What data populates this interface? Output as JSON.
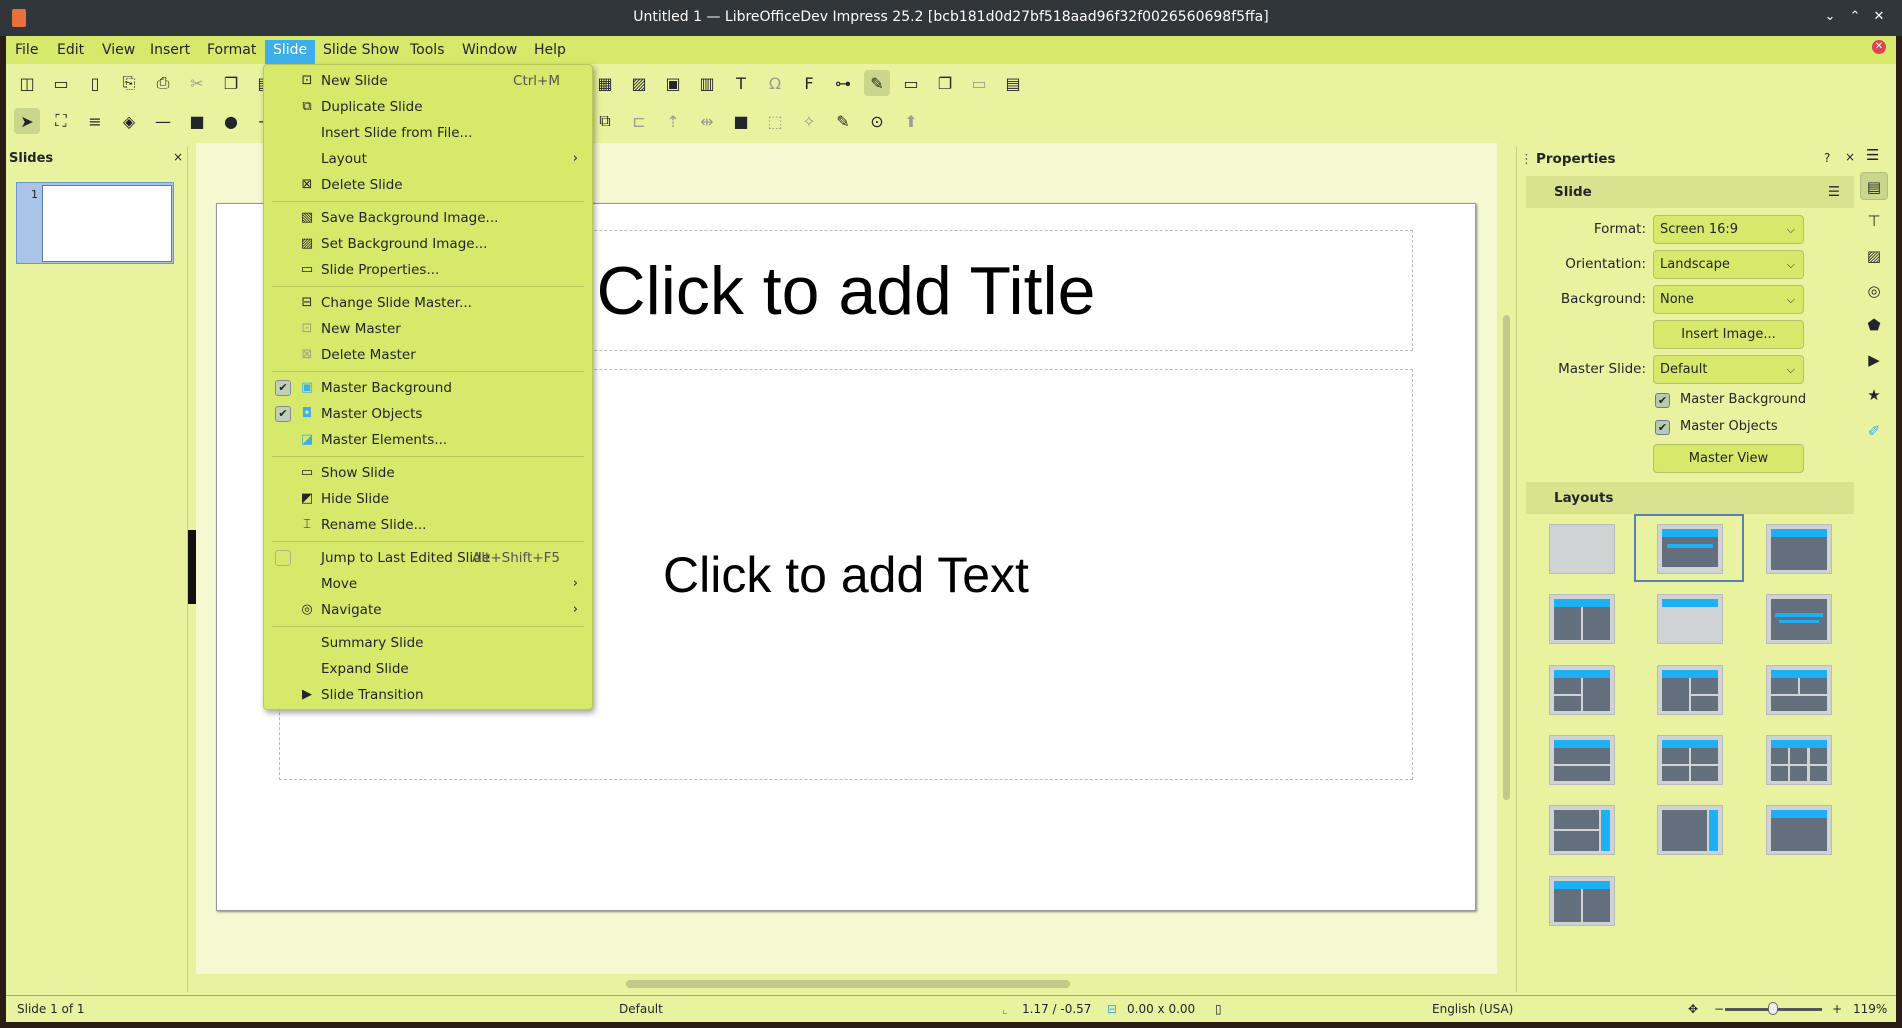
{
  "window": {
    "title": "Untitled 1 — LibreOfficeDev Impress 25.2 [bcb181d0d27bf518aad96f32f0026560698f5ffa]",
    "minimize": "⌄",
    "maximize": "⌃",
    "close": "✕"
  },
  "colors": {
    "menubar": "#d6e96b",
    "panel": "#e9f29e",
    "accent": "#3daee9",
    "layout_title_bar": "#1eb0f5"
  },
  "menubar": {
    "items": [
      "File",
      "Edit",
      "View",
      "Insert",
      "Format",
      "Slide",
      "Slide Show",
      "Tools",
      "Window",
      "Help"
    ],
    "active": "Slide"
  },
  "toolbar1": [
    {
      "n": "templates-icon",
      "g": "◫"
    },
    {
      "n": "open-icon",
      "g": "▭"
    },
    {
      "n": "save-icon",
      "g": "▯"
    },
    {
      "n": "export-pdf-icon",
      "g": "⎘"
    },
    {
      "n": "print-icon",
      "g": "⎙"
    },
    {
      "n": "cut-icon",
      "g": "✂",
      "dim": true
    },
    {
      "n": "copy-icon",
      "g": "❐"
    },
    {
      "n": "paste-icon",
      "g": "▤"
    },
    {
      "n": "clone-icon",
      "g": "✎"
    },
    {
      "n": "undo-icon",
      "g": "↶"
    },
    {
      "n": "redo-icon",
      "g": "↷"
    },
    {
      "n": "spelling-icon",
      "g": "✓"
    },
    {
      "n": "grid-icon",
      "g": "⋮",
      "on": true
    },
    {
      "n": "slide-layout-icon",
      "g": "▦"
    },
    {
      "n": "comment-icon",
      "g": "✐"
    },
    {
      "n": "start-first-slide-icon",
      "g": "▶"
    },
    {
      "n": "start-current-slide-icon",
      "g": "⏸"
    },
    {
      "n": "table-icon",
      "g": "▦"
    },
    {
      "n": "image-icon",
      "g": "▨"
    },
    {
      "n": "media-icon",
      "g": "▣"
    },
    {
      "n": "chart-icon",
      "g": "▥"
    },
    {
      "n": "textbox-icon",
      "g": "T"
    },
    {
      "n": "special-char-icon",
      "g": "Ω",
      "dim": true
    },
    {
      "n": "fontwork-icon",
      "g": "F"
    },
    {
      "n": "hyperlink-icon",
      "g": "⊶"
    },
    {
      "n": "draw-icon",
      "g": "✎",
      "on": true
    },
    {
      "n": "new-slide-icon",
      "g": "▭"
    },
    {
      "n": "duplicate-slide-icon",
      "g": "❐"
    },
    {
      "n": "delete-slide-icon",
      "g": "▭",
      "dim": true
    },
    {
      "n": "display-views-icon",
      "g": "▤"
    }
  ],
  "toolbar2": [
    {
      "n": "select-icon",
      "g": "➤",
      "on": true
    },
    {
      "n": "zoom-pan-icon",
      "g": "⛶"
    },
    {
      "n": "line-color-icon",
      "g": "≡"
    },
    {
      "n": "fill-color-icon",
      "g": "◈"
    },
    {
      "n": "line-icon",
      "g": "—"
    },
    {
      "n": "rectangle-icon",
      "g": "■"
    },
    {
      "n": "ellipse-icon",
      "g": "●"
    },
    {
      "n": "arrow-icon",
      "g": "→"
    },
    {
      "n": "curve-icon",
      "g": "∿"
    },
    {
      "n": "connector-icon",
      "g": "↳"
    },
    {
      "n": "basic-shapes-icon",
      "g": "◆"
    },
    {
      "n": "symbol-shapes-icon",
      "g": "☺"
    },
    {
      "n": "block-arrows-icon",
      "g": "⇨"
    },
    {
      "n": "flowchart-icon",
      "g": "◇"
    },
    {
      "n": "callout-icon",
      "g": "💬"
    },
    {
      "n": "star-icon",
      "g": "★"
    },
    {
      "n": "3d-object-icon",
      "g": "◧"
    },
    {
      "n": "transform-icon",
      "g": "⧉"
    },
    {
      "n": "align-icon",
      "g": "⊏",
      "dim": true
    },
    {
      "n": "arrange-icon",
      "g": "⇡",
      "dim": true
    },
    {
      "n": "distribute-icon",
      "g": "⇹",
      "dim": true
    },
    {
      "n": "shadow-icon",
      "g": "■"
    },
    {
      "n": "crop-icon",
      "g": "⬚",
      "dim": true
    },
    {
      "n": "filter-icon",
      "g": "✧",
      "dim": true
    },
    {
      "n": "points-icon",
      "g": "✎"
    },
    {
      "n": "glue-points-icon",
      "g": "⊙"
    },
    {
      "n": "toggle-extrusion-icon",
      "g": "⬆",
      "dim": true
    }
  ],
  "slide_menu": [
    {
      "icon": "⊡",
      "icon_name": "new-slide-icon",
      "label": "New Slide",
      "shortcut": "Ctrl+M"
    },
    {
      "icon": "⧉",
      "icon_name": "duplicate-slide-icon",
      "label": "Duplicate Slide"
    },
    {
      "label": "Insert Slide from File..."
    },
    {
      "label": "Layout",
      "submenu": true
    },
    {
      "icon": "⊠",
      "icon_name": "delete-slide-icon",
      "label": "Delete Slide",
      "sep_after": true
    },
    {
      "icon": "▧",
      "icon_name": "save-background-icon",
      "label": "Save Background Image..."
    },
    {
      "icon": "▨",
      "icon_name": "set-background-icon",
      "label": "Set Background Image..."
    },
    {
      "icon": "▭",
      "icon_name": "slide-properties-icon",
      "label": "Slide Properties...",
      "sep_after": true
    },
    {
      "icon": "⊟",
      "icon_name": "change-master-icon",
      "label": "Change Slide Master..."
    },
    {
      "icon": "⊡",
      "icon_name": "new-master-icon",
      "label": "New Master"
    },
    {
      "icon": "⊠",
      "icon_name": "delete-master-icon",
      "label": "Delete Master",
      "sep_after": true
    },
    {
      "icon": "▣",
      "icon_name": "master-background-icon",
      "label": "Master Background",
      "check": true
    },
    {
      "icon": "◘",
      "icon_name": "master-objects-icon",
      "label": "Master Objects",
      "check": true
    },
    {
      "icon": "◪",
      "icon_name": "master-elements-icon",
      "label": "Master Elements...",
      "sep_after": true
    },
    {
      "icon": "▭",
      "icon_name": "show-slide-icon",
      "label": "Show Slide"
    },
    {
      "icon": "◩",
      "icon_name": "hide-slide-icon",
      "label": "Hide Slide"
    },
    {
      "icon": "⌶",
      "icon_name": "rename-slide-icon",
      "label": "Rename Slide...",
      "sep_after": true
    },
    {
      "label": "Jump to Last Edited Slide",
      "shortcut": "Alt+Shift+F5",
      "check": false
    },
    {
      "label": "Move",
      "submenu": true
    },
    {
      "icon": "◎",
      "icon_name": "navigate-icon",
      "label": "Navigate",
      "submenu": true,
      "sep_after": true
    },
    {
      "label": "Summary Slide"
    },
    {
      "label": "Expand Slide"
    },
    {
      "icon": "▶",
      "icon_name": "slide-transition-icon",
      "label": "Slide Transition"
    }
  ],
  "slides_panel": {
    "title": "Slides",
    "close": "×",
    "thumb_number": "1"
  },
  "slide": {
    "title_placeholder": "Click to add Title",
    "text_placeholder": "Click to add Text"
  },
  "properties": {
    "title": "Properties",
    "help": "?",
    "close": "×",
    "menu": "☰",
    "section_slide": "Slide",
    "section_menu": "☰",
    "format_label": "Format:",
    "format_value": "Screen 16:9",
    "orientation_label": "Orientation:",
    "orientation_value": "Landscape",
    "background_label": "Background:",
    "background_value": "None",
    "insert_image": "Insert Image...",
    "master_slide_label": "Master Slide:",
    "master_slide_value": "Default",
    "master_background": "Master Background",
    "master_background_checked": true,
    "master_objects": "Master Objects",
    "master_objects_checked": true,
    "master_view": "Master View",
    "section_layouts": "Layouts",
    "layouts": [
      "Blank Slide",
      "Title Slide",
      "Title, Content",
      "Title and 2 Content",
      "Title Only",
      "Centered Text",
      "Title, 2 Content and Content",
      "Title, Content and 2 Content",
      "Title, 2 Content over Content",
      "Title, Content over Content",
      "Title, 4 Content",
      "Title, 6 Content",
      "Vertical Title, Vertical Text",
      "Vertical Title, Text",
      "Title, Vertical Text",
      "Title, 2 Vertical Text"
    ],
    "selected_layout": "Title Slide"
  },
  "sidebar_tabs": [
    {
      "n": "properties-tab-icon",
      "g": "▤",
      "on": true
    },
    {
      "n": "styles-tab-icon",
      "g": "⊤"
    },
    {
      "n": "gallery-tab-icon",
      "g": "▨"
    },
    {
      "n": "navigator-tab-icon",
      "g": "◎"
    },
    {
      "n": "shapes-tab-icon",
      "g": "⬟"
    },
    {
      "n": "slide-transition-tab-icon",
      "g": "▶"
    },
    {
      "n": "animation-tab-icon",
      "g": "★"
    },
    {
      "n": "master-slides-tab-icon",
      "g": "✐"
    }
  ],
  "status": {
    "slide": "Slide 1 of 1",
    "master": "Default",
    "position": "1.17 / -0.57",
    "size": "0.00 x 0.00",
    "language": "English (USA)",
    "zoom_minus": "−",
    "zoom_plus": "+",
    "zoom": "119%",
    "zoom_percent": 119
  }
}
